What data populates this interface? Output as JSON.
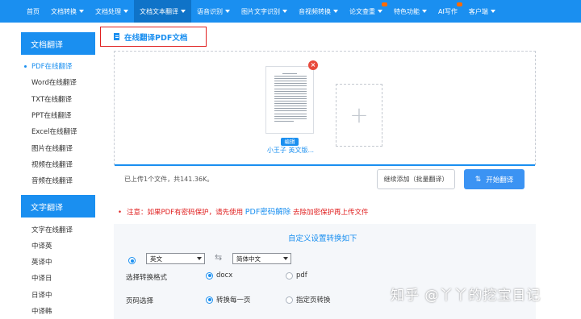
{
  "nav": {
    "items": [
      {
        "label": "首页",
        "caret": false
      },
      {
        "label": "文档转换",
        "caret": true
      },
      {
        "label": "文档处理",
        "caret": true
      },
      {
        "label": "文档文本翻译",
        "caret": true,
        "active": true
      },
      {
        "label": "语音识别",
        "caret": true
      },
      {
        "label": "图片文字识别",
        "caret": true
      },
      {
        "label": "音视频转换",
        "caret": true
      },
      {
        "label": "论文查重",
        "caret": true
      },
      {
        "label": "特色功能",
        "caret": true
      },
      {
        "label": "AI写作",
        "caret": false
      },
      {
        "label": "客户端",
        "caret": true
      }
    ]
  },
  "sidebar": {
    "section1": {
      "title": "文档翻译",
      "items": [
        "PDF在线翻译",
        "Word在线翻译",
        "TXT在线翻译",
        "PPT在线翻译",
        "Excel在线翻译",
        "图片在线翻译",
        "视频在线翻译",
        "音频在线翻译"
      ],
      "active_index": 0
    },
    "section2": {
      "title": "文字翻译",
      "items": [
        "文字在线翻译",
        "中译英",
        "英译中",
        "中译日",
        "日译中",
        "中译韩"
      ]
    }
  },
  "main": {
    "title": "在线翻译PDF文档",
    "file": {
      "name": "小王子 英文版...",
      "edit_label": "编辑",
      "remove": "×"
    },
    "add_symbol": "+",
    "upload_info": "已上传1个文件，共141.36K。",
    "continue_label": "继续添加（批量翻译）",
    "start_label": "开始翻译",
    "start_icon": "⇅",
    "notice": {
      "bullet": "•",
      "prefix": "注意：如果PDF有密码保护，请先使用",
      "link": "PDF密码解除",
      "suffix": "去除加密保护再上传文件"
    },
    "settings": {
      "title": "自定义设置转换如下",
      "source_lang": "英文",
      "target_lang": "简体中文",
      "swap_icon": "⇆",
      "format_label": "选择转换格式",
      "format_options": [
        "docx",
        "pdf"
      ],
      "format_selected": "docx",
      "page_label": "页码选择",
      "page_options": [
        "转换每一页",
        "指定页转换"
      ],
      "page_selected": "转换每一页"
    }
  },
  "watermark": "知乎 @丫丫的挖宝日记"
}
